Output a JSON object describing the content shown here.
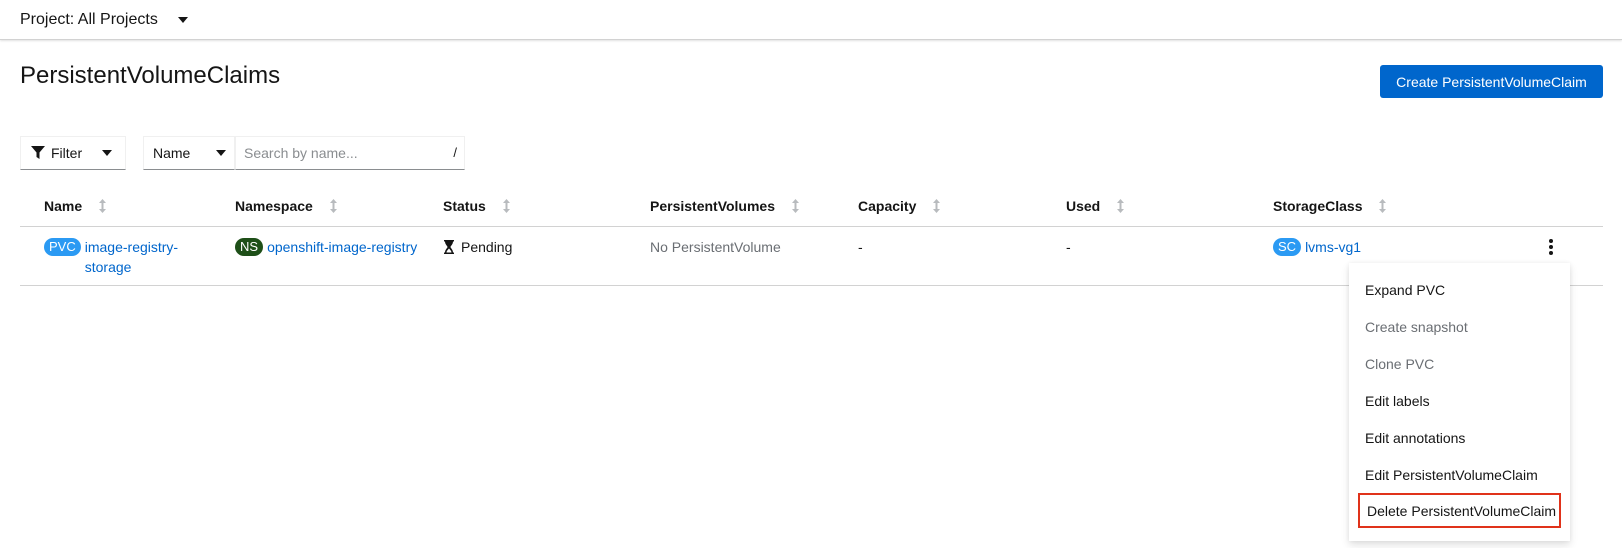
{
  "header": {
    "project_label": "Project: All Projects"
  },
  "page": {
    "title": "PersistentVolumeClaims",
    "create_button": "Create PersistentVolumeClaim"
  },
  "toolbar": {
    "filter_label": "Filter",
    "name_label": "Name",
    "search_placeholder": "Search by name...",
    "search_shortcut": "/"
  },
  "table": {
    "columns": [
      "Name",
      "Namespace",
      "Status",
      "PersistentVolumes",
      "Capacity",
      "Used",
      "StorageClass"
    ],
    "rows": [
      {
        "name_badge": "PVC",
        "name_line1": "image-registry-",
        "name_line2": "storage",
        "namespace_badge": "NS",
        "namespace": "openshift-image-registry",
        "status": "Pending",
        "persistent_volume": "No PersistentVolume",
        "capacity": "-",
        "used": "-",
        "storageclass_badge": "SC",
        "storageclass": "lvms-vg1"
      }
    ]
  },
  "menu": {
    "items": [
      {
        "label": "Expand PVC",
        "disabled": false
      },
      {
        "label": "Create snapshot",
        "disabled": true
      },
      {
        "label": "Clone PVC",
        "disabled": true
      },
      {
        "label": "Edit labels",
        "disabled": false
      },
      {
        "label": "Edit annotations",
        "disabled": false
      },
      {
        "label": "Edit PersistentVolumeClaim",
        "disabled": false
      },
      {
        "label": "Delete PersistentVolumeClaim",
        "disabled": false,
        "highlighted": true
      }
    ]
  },
  "colors": {
    "primary": "#0066cc",
    "pvc_badge": "#2b9af3",
    "ns_badge": "#1e4f18",
    "sc_badge": "#2b9af3",
    "highlight_border": "#e0321a"
  }
}
